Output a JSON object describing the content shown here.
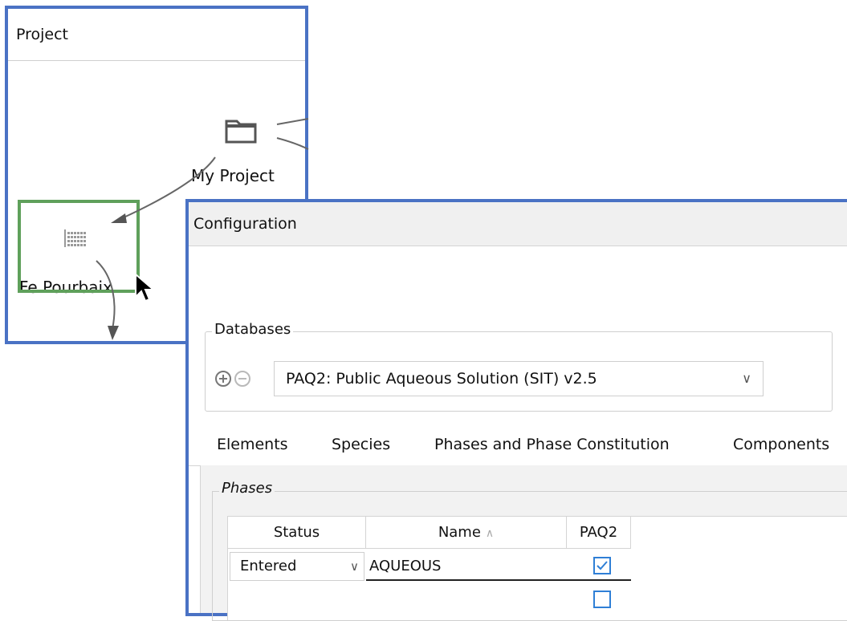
{
  "project_window": {
    "title": "Project",
    "nodes": [
      {
        "label": "My Project",
        "icon": "folder-icon"
      },
      {
        "label": "Fe Pourbaix",
        "icon": "grid-calculation-icon"
      }
    ]
  },
  "config_window": {
    "title": "Configuration",
    "databases": {
      "legend": "Databases",
      "selected": "PAQ2: Public Aqueous Solution (SIT) v2.5"
    },
    "tabs": [
      {
        "label": "Elements"
      },
      {
        "label": "Species"
      },
      {
        "label": "Phases and Phase Constitution"
      },
      {
        "label": "Components"
      }
    ],
    "active_tab": "Phases and Phase Constitution",
    "phases": {
      "legend": "Phases",
      "columns": [
        "Status",
        "Name",
        "PAQ2"
      ],
      "rows": [
        {
          "status": "Entered",
          "name": "AQUEOUS",
          "paq2": true
        }
      ]
    }
  },
  "colors": {
    "window_border": "#4a72c4",
    "selection_border": "#5fa05b",
    "checkbox": "#2f7fd6",
    "active_tab_underline": "#8fb1d8"
  }
}
